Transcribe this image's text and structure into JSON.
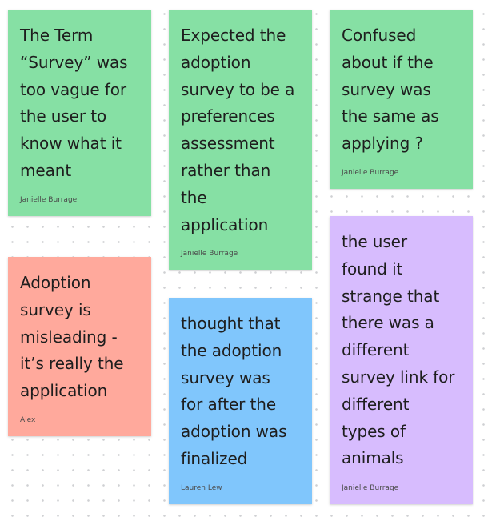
{
  "notes": [
    {
      "text": "The Term\n“Survey” was\ntoo vague for\nthe user to\nknow what it\nmeant",
      "author": "Janielle Burrage",
      "color": "#86e0a4"
    },
    {
      "text": "Expected the\nadoption\nsurvey to be a\npreferences\nassessment\nrather than\nthe\napplication",
      "author": "Janielle Burrage",
      "color": "#86e0a4"
    },
    {
      "text": "Confused\nabout if the\nsurvey was\nthe same as\napplying ?",
      "author": "Janielle Burrage",
      "color": "#86e0a4"
    },
    {
      "text": "Adoption\nsurvey is\nmisleading -\nit’s really the\napplication",
      "author": "Alex",
      "color": "#ffa99c"
    },
    {
      "text": "thought that\nthe adoption\nsurvey was\nfor after the\nadoption was\nfinalized",
      "author": "Lauren Lew",
      "color": "#80c6fc"
    },
    {
      "text": "the user\nfound it\nstrange that\nthere was a\ndifferent\nsurvey link for\ndifferent\ntypes of\nanimals",
      "author": "Janielle Burrage",
      "color": "#d7bcfe"
    }
  ]
}
